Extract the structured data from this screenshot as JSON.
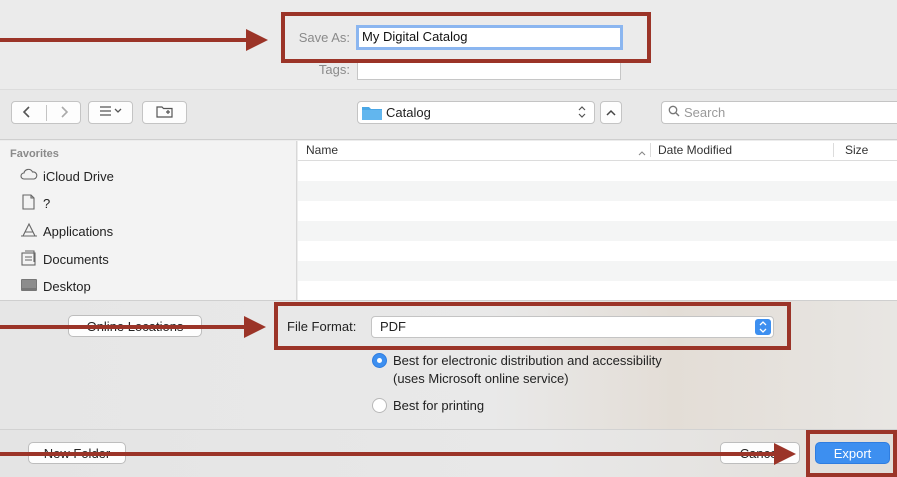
{
  "save_as": {
    "label": "Save As:",
    "value": "My Digital Catalog"
  },
  "tags": {
    "label": "Tags:",
    "value": ""
  },
  "toolbar": {
    "location": "Catalog",
    "search_placeholder": "Search"
  },
  "sidebar": {
    "heading": "Favorites",
    "items": [
      {
        "label": "iCloud Drive",
        "icon": "cloud-icon"
      },
      {
        "label": "?",
        "icon": "document-icon"
      },
      {
        "label": "Applications",
        "icon": "applications-icon"
      },
      {
        "label": "Documents",
        "icon": "documents-folder-icon"
      },
      {
        "label": "Desktop",
        "icon": "desktop-icon"
      }
    ]
  },
  "columns": {
    "name": "Name",
    "date_modified": "Date Modified",
    "size": "Size"
  },
  "buttons": {
    "online_locations": "Online Locations",
    "new_folder": "New Folder",
    "cancel": "Cancel",
    "export": "Export"
  },
  "file_format": {
    "label": "File Format:",
    "value": "PDF"
  },
  "options": {
    "option_1_line_1": "Best for electronic distribution and accessibility",
    "option_1_line_2": "(uses Microsoft online service)",
    "option_2": "Best for printing",
    "selected": "option_1"
  },
  "colors": {
    "accent": "#3d8ff0",
    "annotation": "#9b3428"
  }
}
